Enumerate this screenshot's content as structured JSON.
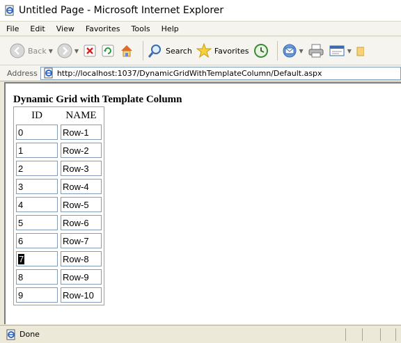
{
  "window": {
    "title": "Untitled Page - Microsoft Internet Explorer"
  },
  "menu": {
    "items": [
      "File",
      "Edit",
      "View",
      "Favorites",
      "Tools",
      "Help"
    ]
  },
  "toolbar": {
    "back_label": "Back",
    "search_label": "Search",
    "favorites_label": "Favorites"
  },
  "address": {
    "label": "Address",
    "url": "http://localhost:1037/DynamicGridWithTemplateColumn/Default.aspx"
  },
  "page": {
    "heading": "Dynamic Grid with Template Column",
    "columns": [
      "ID",
      "NAME"
    ],
    "rows": [
      {
        "id": "0",
        "name": "Row-1"
      },
      {
        "id": "1",
        "name": "Row-2"
      },
      {
        "id": "2",
        "name": "Row-3"
      },
      {
        "id": "3",
        "name": "Row-4"
      },
      {
        "id": "4",
        "name": "Row-5"
      },
      {
        "id": "5",
        "name": "Row-6"
      },
      {
        "id": "6",
        "name": "Row-7"
      },
      {
        "id": "7",
        "name": "Row-8"
      },
      {
        "id": "8",
        "name": "Row-9"
      },
      {
        "id": "9",
        "name": "Row-10"
      }
    ],
    "selected_row_index": 7
  },
  "status": {
    "text": "Done"
  }
}
